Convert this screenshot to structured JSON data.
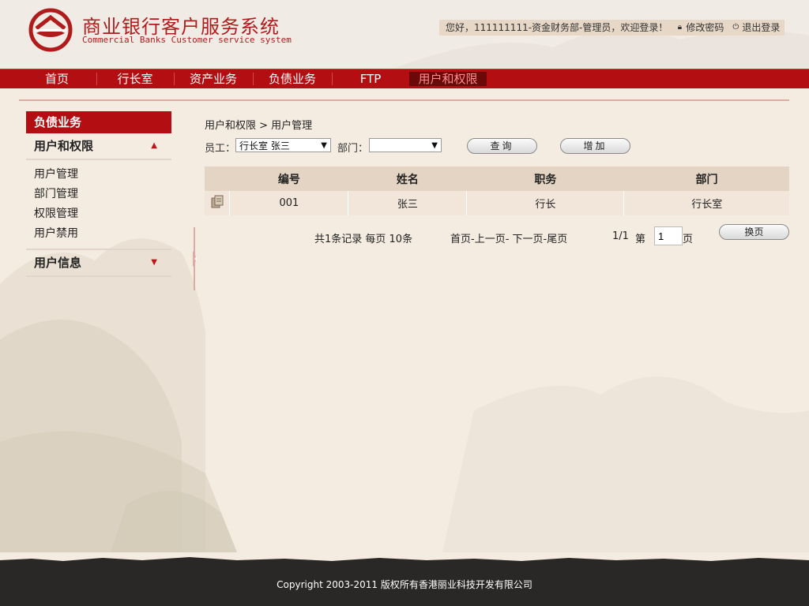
{
  "header": {
    "title": "商业银行客户服务系统",
    "subtitle": "Commercial Banks Customer service system",
    "welcome": "您好，111111111-资金财务部-管理员，欢迎登录！",
    "change_password": "修改密码",
    "logout": "退出登录"
  },
  "nav": {
    "items": [
      "首页",
      "行长室",
      "资产业务",
      "负债业务",
      "FTP",
      "用户和权限"
    ],
    "active_index": 5
  },
  "sidebar": {
    "section_title": "负债业务",
    "groups": [
      {
        "label": "用户和权限",
        "expanded": true,
        "items": [
          "用户管理",
          "部门管理",
          "权限管理",
          "用户禁用"
        ]
      },
      {
        "label": "用户信息",
        "expanded": false,
        "items": []
      }
    ]
  },
  "main": {
    "breadcrumb": "用户和权限 > 用户管理",
    "filters": {
      "employee_label": "员工：",
      "employee_value": "行长室 张三",
      "department_label": "部门：",
      "department_value": "",
      "query_button": "查询",
      "add_button": "增加"
    },
    "table": {
      "columns": [
        "编号",
        "姓名",
        "职务",
        "部门"
      ],
      "rows": [
        {
          "id": "001",
          "name": "张三",
          "title": "行长",
          "dept": "行长室"
        }
      ]
    },
    "pager": {
      "summary": "共1条记录 每页 10条",
      "links": "首页-上一页- 下一页-尾页",
      "page_info": "1/1",
      "page_prefix": "第",
      "page_value": "1",
      "page_suffix": "页",
      "go_button": "换页"
    }
  },
  "footer": {
    "copyright": "Copyright 2003-2011 版权所有香港丽业科技开发有限公司"
  },
  "colors": {
    "brand_red": "#b30f12",
    "dark_red": "#6b0808",
    "background": "#f4ebe1",
    "footer": "#2a2826"
  }
}
